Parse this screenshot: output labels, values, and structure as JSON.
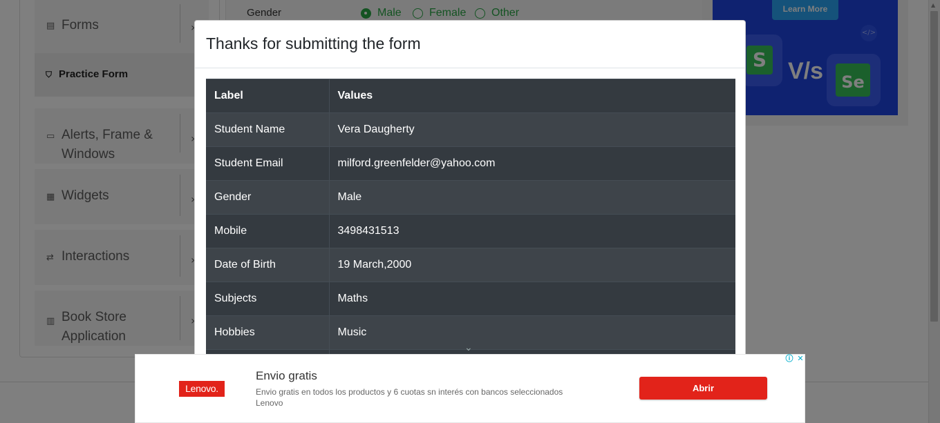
{
  "background": {
    "sidebar": {
      "groups": [
        {
          "label": "Forms",
          "icon": "document-icon"
        },
        {
          "label": "Alerts, Frame &",
          "label2": "Windows",
          "icon": "window-icon"
        },
        {
          "label": "Widgets",
          "icon": "widgets-icon"
        },
        {
          "label": "Interactions",
          "icon": "interactions-icon"
        },
        {
          "label": "Book Store",
          "label2": "Application",
          "icon": "books-icon"
        }
      ],
      "active_item": {
        "label": "Practice Form",
        "icon": "html5-icon"
      }
    },
    "form_strip": {
      "gender_label": "Gender",
      "options": [
        "Male",
        "Female",
        "Other"
      ],
      "selected": "Male"
    },
    "top_ad": {
      "button_label": "Learn More",
      "left_badge": "S",
      "versus": "V/s",
      "right_badge": "Se"
    }
  },
  "modal": {
    "title": "Thanks for submitting the form",
    "table": {
      "headers": [
        "Label",
        "Values"
      ],
      "rows": [
        [
          "Student Name",
          "Vera Daugherty"
        ],
        [
          "Student Email",
          "milford.greenfelder@yahoo.com"
        ],
        [
          "Gender",
          "Male"
        ],
        [
          "Mobile",
          "3498431513"
        ],
        [
          "Date of Birth",
          "19 March,2000"
        ],
        [
          "Subjects",
          "Maths"
        ],
        [
          "Hobbies",
          "Music"
        ]
      ]
    }
  },
  "bottom_ad": {
    "brand": "Lenovo.",
    "title": "Envio gratis",
    "description": "Envio gratis en todos los productos y 6 cuotas sn interés con bancos seleccionados",
    "advertiser": "Lenovo",
    "cta_label": "Abrir",
    "info_glyph": "ⓘ",
    "close_glyph": "✕"
  },
  "colors": {
    "accent_green": "#28a745",
    "table_dark": "#343a40",
    "table_stripe": "#3e444a",
    "lenovo_red": "#e2231a",
    "ad_blue": "#1e44e0"
  }
}
